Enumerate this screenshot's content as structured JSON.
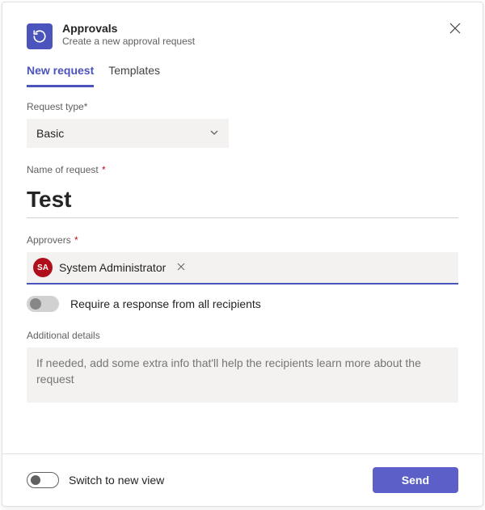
{
  "header": {
    "title": "Approvals",
    "subtitle": "Create a new approval request"
  },
  "tabs": {
    "new_request": "New request",
    "templates": "Templates"
  },
  "fields": {
    "request_type": {
      "label": "Request type*",
      "value": "Basic"
    },
    "name": {
      "label": "Name of request ",
      "required_mark": "*",
      "value": "Test"
    },
    "approvers": {
      "label": "Approvers ",
      "required_mark": "*",
      "chip": {
        "initials": "SA",
        "name": "System Administrator"
      },
      "require_response_label": "Require a response from all recipients"
    },
    "details": {
      "label": "Additional details",
      "placeholder": "If needed, add some extra info that'll help the recipients learn more about the request"
    }
  },
  "footer": {
    "switch_label": "Switch to new view",
    "send_label": "Send"
  },
  "colors": {
    "accent": "#5b5fc7",
    "required": "#b10e1c"
  }
}
